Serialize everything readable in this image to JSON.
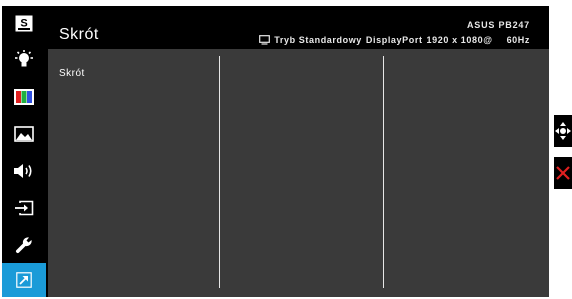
{
  "header": {
    "title": "Skrót",
    "model": "ASUS PB247",
    "mode": "Tryb Standardowy",
    "input": "DisplayPort",
    "resolution": "1920 x 1080@",
    "refresh": "60Hz"
  },
  "menu": {
    "first_item": "Skrót"
  },
  "sidebar": {
    "items": [
      {
        "name": "splendid",
        "icon": "splendid-s-icon"
      },
      {
        "name": "brightness",
        "icon": "blue-light-icon"
      },
      {
        "name": "color",
        "icon": "color-bars-icon"
      },
      {
        "name": "image",
        "icon": "image-icon"
      },
      {
        "name": "sound",
        "icon": "speaker-icon"
      },
      {
        "name": "input",
        "icon": "input-select-icon"
      },
      {
        "name": "system",
        "icon": "wrench-icon"
      },
      {
        "name": "shortcut",
        "icon": "shortcut-arrow-icon",
        "active": true
      }
    ],
    "active_color": "#1a9bd8"
  },
  "nav_buttons": [
    {
      "name": "navigate",
      "icon": "four-way-arrow-icon"
    },
    {
      "name": "exit",
      "icon": "close-icon",
      "color": "#e02020"
    }
  ]
}
